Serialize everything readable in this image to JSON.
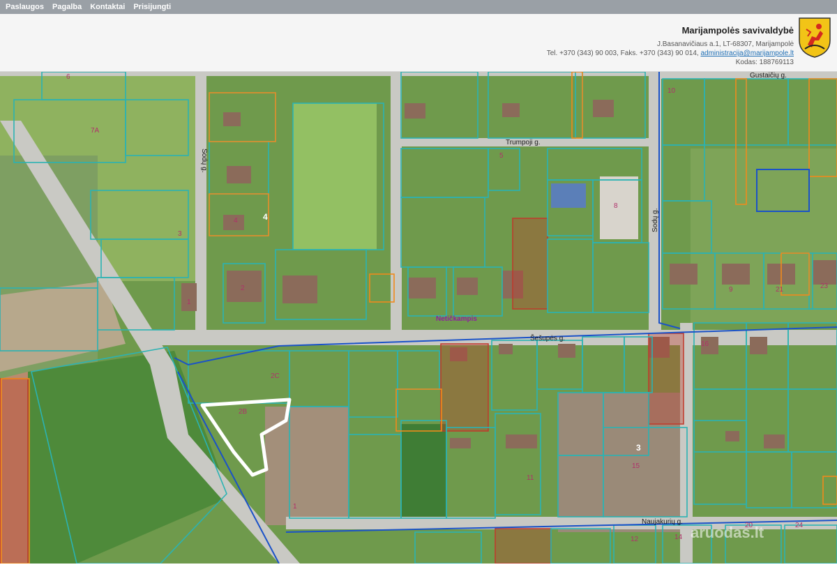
{
  "nav": {
    "items": [
      "Paslaugos",
      "Pagalba",
      "Kontaktai",
      "Prisijungti"
    ]
  },
  "header": {
    "org_name": "Marijampolės savivaldybė",
    "address": "J.Basanavičiaus a.1, LT-68307, Marijampolė",
    "phone_fax": "Tel. +370 (343) 90 003, Faks. +370 (343) 90 014,",
    "email": "administracija@marijampole.lt",
    "code": "Kodas: 188769113",
    "crest_icon": "coat-of-arms-icon"
  },
  "map": {
    "streets": {
      "gustaiciu": "Gustaičių g.",
      "trumpoji": "Trumpoji g.",
      "sesupes": "Šešupės g.",
      "naujakuriu": "Naujakurių g.",
      "sodu": "Sodų g.",
      "netickampis": "Netičkampis"
    },
    "block_numbers": [
      "4",
      "3"
    ],
    "parcel_numbers": {
      "p6": "6",
      "p7a": "7A",
      "p4": "4",
      "p2": "2",
      "p1": "1",
      "p2b": "2B",
      "p2c": "2C",
      "p15": "15",
      "p5": "5",
      "p10": "10",
      "p12": "12",
      "p14": "14",
      "p24": "24",
      "p20": "20",
      "p9": "9",
      "p11": "11",
      "p21": "21",
      "p23": "23",
      "p16": "16",
      "p8": "8",
      "p3": "3"
    },
    "watermark": "aruodas.lt",
    "colors": {
      "parcel_border": "#2bb3b3",
      "road_border": "#1a52c8",
      "private_border": "#f08a1c",
      "selected_parcel": "#ffffff",
      "restricted_fill": "#c0392b",
      "field_green": "#4e8a3a",
      "road_gray": "#c9c9c4"
    }
  }
}
